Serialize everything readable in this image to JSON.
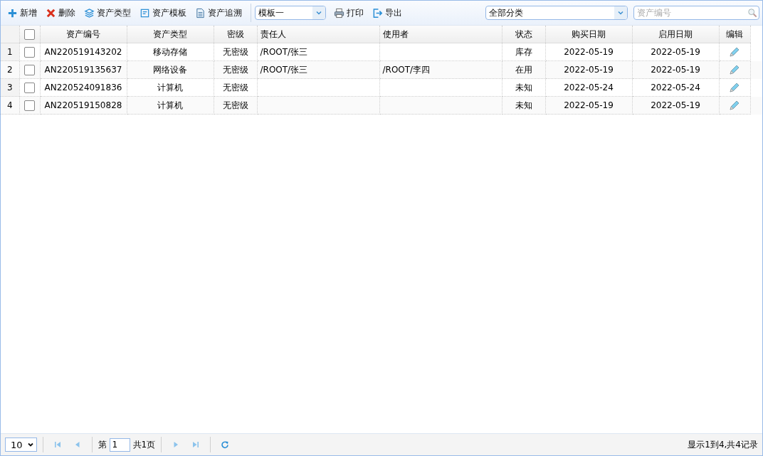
{
  "toolbar": {
    "buttons": [
      {
        "kind": "add",
        "label": "新增"
      },
      {
        "kind": "delete",
        "label": "删除"
      },
      {
        "kind": "layers",
        "label": "资产类型"
      },
      {
        "kind": "template",
        "label": "资产模板"
      },
      {
        "kind": "document",
        "label": "资产追溯"
      }
    ],
    "template_select": {
      "value": "模板一"
    },
    "buttons_after": [
      {
        "kind": "print",
        "label": "打印"
      },
      {
        "kind": "export",
        "label": "导出"
      }
    ],
    "category_select": {
      "value": "全部分类"
    },
    "search": {
      "placeholder": "资产编号"
    }
  },
  "table": {
    "header_checked": false,
    "columns": [
      "资产编号",
      "资产类型",
      "密级",
      "责任人",
      "使用者",
      "状态",
      "购买日期",
      "启用日期",
      "编辑"
    ],
    "rows": [
      {
        "number": "1",
        "checked": false,
        "cells": [
          "AN220519143202",
          "移动存储",
          "无密级",
          "/ROOT/张三",
          "",
          "库存",
          "2022-05-19",
          "2022-05-19"
        ]
      },
      {
        "number": "2",
        "checked": false,
        "cells": [
          "AN220519135637",
          "网络设备",
          "无密级",
          "/ROOT/张三",
          "/ROOT/李四",
          "在用",
          "2022-05-19",
          "2022-05-19"
        ]
      },
      {
        "number": "3",
        "checked": false,
        "cells": [
          "AN220524091836",
          "计算机",
          "无密级",
          "",
          "",
          "未知",
          "2022-05-24",
          "2022-05-24"
        ]
      },
      {
        "number": "4",
        "checked": false,
        "cells": [
          "AN220519150828",
          "计算机",
          "无密级",
          "",
          "",
          "未知",
          "2022-05-19",
          "2022-05-19"
        ]
      }
    ]
  },
  "pager": {
    "page_size": "10",
    "page_prefix": "第",
    "page": "1",
    "page_suffix": "共1页",
    "summary": "显示1到4,共4记录"
  }
}
